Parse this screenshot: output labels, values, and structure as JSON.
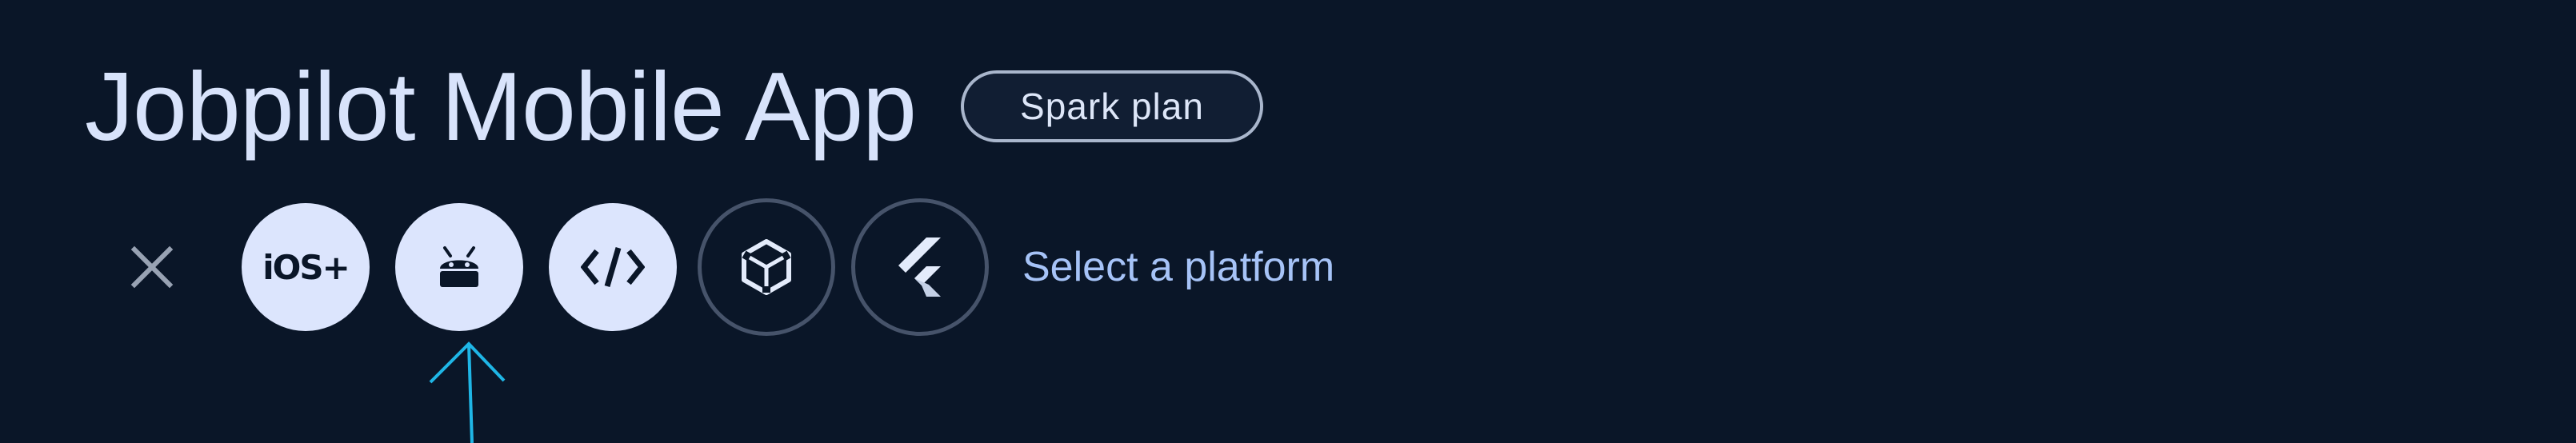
{
  "header": {
    "title": "Jobpilot Mobile App",
    "plan_badge": "Spark plan"
  },
  "platforms": {
    "close_icon": "close-icon",
    "items": [
      {
        "id": "ios",
        "label": "iOS+",
        "icon": "ios-plus-icon",
        "state": "filled"
      },
      {
        "id": "android",
        "label": "",
        "icon": "android-icon",
        "state": "filled"
      },
      {
        "id": "web",
        "label": "",
        "icon": "code-brackets-icon",
        "state": "filled"
      },
      {
        "id": "unity",
        "label": "",
        "icon": "unity-icon",
        "state": "outline"
      },
      {
        "id": "flutter",
        "label": "",
        "icon": "flutter-icon",
        "state": "outline"
      }
    ],
    "prompt": "Select a platform"
  },
  "colors": {
    "background": "#0a1628",
    "title_text": "#d8e3fb",
    "filled_circle": "#dce5fd",
    "outline_circle": "#46536a",
    "link_text": "#a6c3f7",
    "annotation_arrow": "#1fb6e6"
  }
}
